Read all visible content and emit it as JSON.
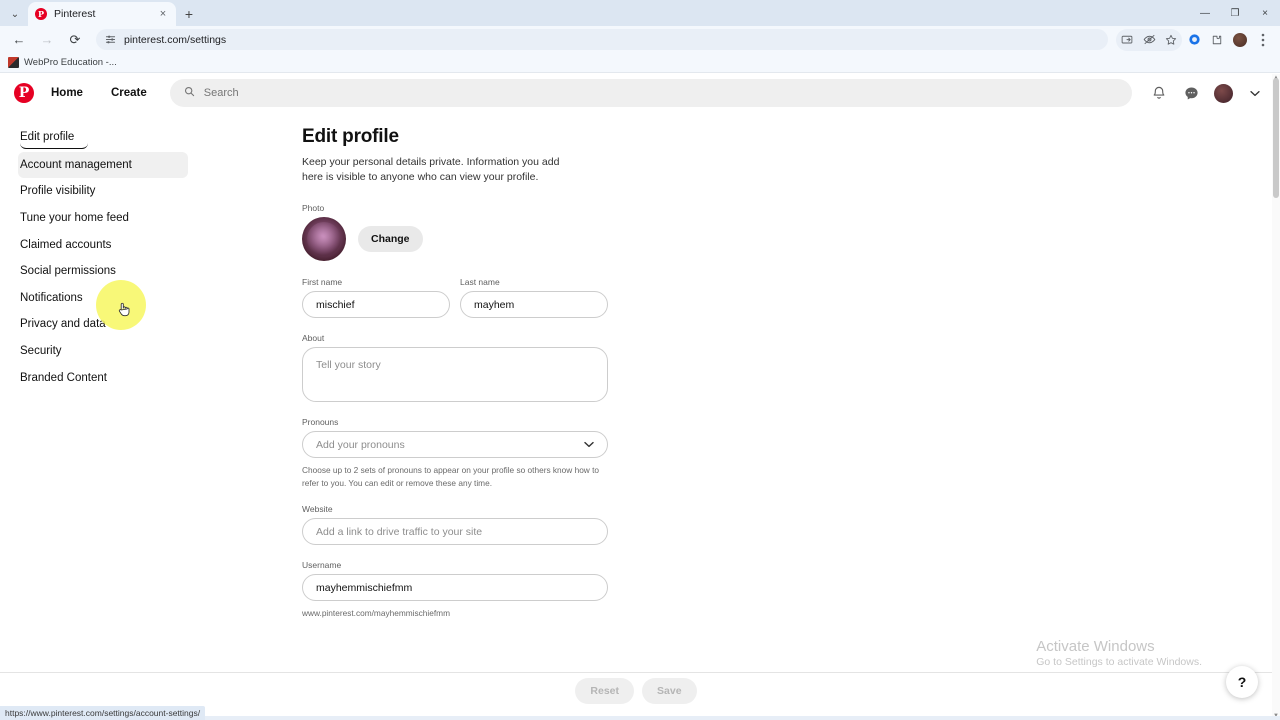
{
  "browser": {
    "tab": {
      "title": "Pinterest",
      "favicon": "pinterest-icon",
      "close": "×"
    },
    "tab_list_icon": "⌄",
    "new_tab": "+",
    "window_controls": {
      "minimize": "—",
      "maximize": "❐",
      "close": "×"
    },
    "nav": {
      "back": "←",
      "forward": "→",
      "reload": "⟳"
    },
    "omnibox": {
      "url": "pinterest.com/settings",
      "site_settings_icon": "tune-icon"
    },
    "toolbar_icons": [
      "cast-icon",
      "tracking-protection-icon",
      "bookmark-star-icon",
      "profile-sync-icon",
      "extensions-icon",
      "browser-avatar",
      "kebab-menu-icon"
    ],
    "bookmark": {
      "label": "WebPro Education -..."
    },
    "status_url": "https://www.pinterest.com/settings/account-settings/"
  },
  "pinterest_header": {
    "logo": "pinterest-logo",
    "nav": [
      {
        "label": "Home"
      },
      {
        "label": "Create"
      }
    ],
    "search": {
      "placeholder": "Search",
      "icon": "search-icon"
    },
    "actions": [
      {
        "name": "notifications-icon",
        "glyph": "🔔"
      },
      {
        "name": "messages-icon",
        "glyph": "💬"
      }
    ],
    "account_chevron": "⌄"
  },
  "sidebar": {
    "items": [
      {
        "label": "Edit profile",
        "state": "selected"
      },
      {
        "label": "Account management",
        "state": "hovered"
      },
      {
        "label": "Profile visibility",
        "state": "default"
      },
      {
        "label": "Tune your home feed",
        "state": "default"
      },
      {
        "label": "Claimed accounts",
        "state": "default"
      },
      {
        "label": "Social permissions",
        "state": "default"
      },
      {
        "label": "Notifications",
        "state": "default"
      },
      {
        "label": "Privacy and data",
        "state": "default"
      },
      {
        "label": "Security",
        "state": "default"
      },
      {
        "label": "Branded Content",
        "state": "default"
      }
    ]
  },
  "main": {
    "title": "Edit profile",
    "subtitle": "Keep your personal details private. Information you add here is visible to anyone who can view your profile.",
    "photo": {
      "label": "Photo",
      "change_button": "Change",
      "avatar": "user-avatar"
    },
    "first_name": {
      "label": "First name",
      "value": "mischief"
    },
    "last_name": {
      "label": "Last name",
      "value": "mayhem"
    },
    "about": {
      "label": "About",
      "placeholder": "Tell your story",
      "value": ""
    },
    "pronouns": {
      "label": "Pronouns",
      "placeholder": "Add your pronouns",
      "chevron": "⌄",
      "helper": "Choose up to 2 sets of pronouns to appear on your profile so others know how to refer to you. You can edit or remove these any time."
    },
    "website": {
      "label": "Website",
      "placeholder": "Add a link to drive traffic to your site",
      "value": ""
    },
    "username": {
      "label": "Username",
      "value": "mayhemmischiefmm",
      "helper": "www.pinterest.com/mayhemmischiefmm"
    }
  },
  "footer": {
    "reset_label": "Reset",
    "save_label": "Save"
  },
  "help_fab": {
    "glyph": "?"
  },
  "watermark": {
    "line1": "Activate Windows",
    "line2": "Go to Settings to activate Windows."
  },
  "colors": {
    "brand_red": "#e60023",
    "cursor_highlight": "#f7f760",
    "chrome_blue": "#dce6f2"
  }
}
